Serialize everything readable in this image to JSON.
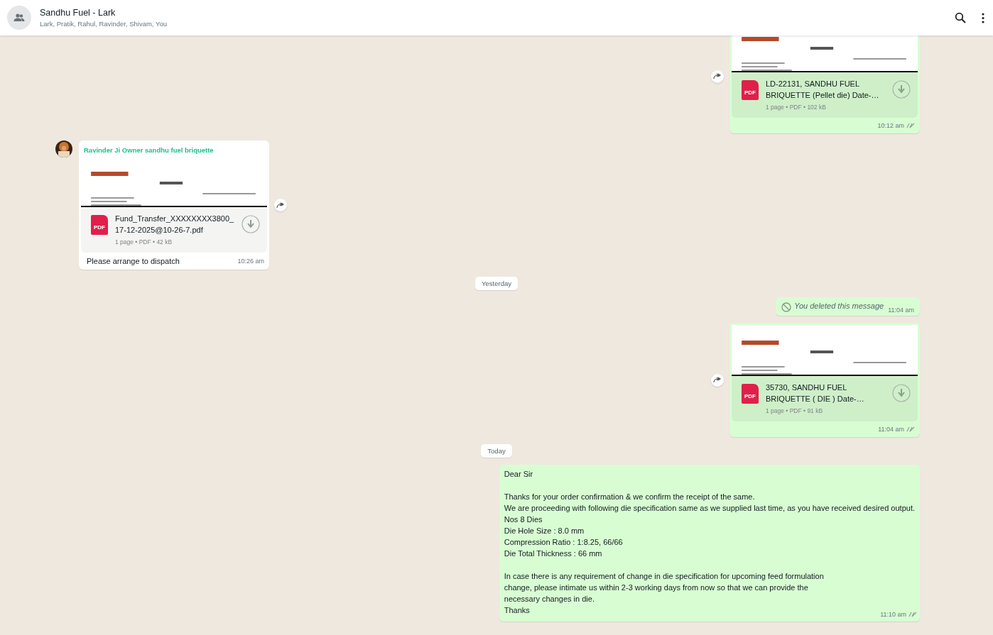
{
  "header": {
    "title": "Sandhu Fuel - Lark",
    "members": "Lark, Pratik, Rahul, Ravinder, Shivam, You"
  },
  "messages": [
    {
      "kind": "document",
      "outgoing": true,
      "file_name": "LD-22131, SANDHU FUEL BRIQUETTE (Pellet die) Date-…",
      "badge": "PDF",
      "meta": "1 page • PDF • 102 kB",
      "time": "10:12 am",
      "read": false
    },
    {
      "kind": "document",
      "outgoing": false,
      "sender": "Ravinder Ji Owner sandhu fuel briquette",
      "file_name": "Fund_Transfer_XXXXXXXX3800_17-12-2025@10-26-7.pdf",
      "badge": "PDF",
      "meta": "1 page • PDF • 42 kB",
      "caption": "Please arrange to dispatch",
      "time": "10:26 am"
    },
    {
      "kind": "date",
      "label": "Yesterday"
    },
    {
      "kind": "deleted",
      "outgoing": true,
      "text": "You deleted this message",
      "time": "11:04 am"
    },
    {
      "kind": "document",
      "outgoing": true,
      "file_name": "35730, SANDHU FUEL BRIQUETTE ( DIE ) Date-…",
      "badge": "PDF",
      "meta": "1 page • PDF • 91 kB",
      "time": "11:04 am",
      "read": false
    },
    {
      "kind": "date",
      "label": "Today"
    },
    {
      "kind": "text",
      "outgoing": true,
      "paragraphs": [
        "Dear Sir",
        "Thanks for your order confirmation & we confirm the receipt of the same.\nWe are proceeding with following die specification same as we supplied last time, as you have received desired output.\nNos 8 Dies\nDie Hole Size : 8.0 mm\nCompression Ratio : 1:8.25, 66/66\nDie Total Thickness : 66 mm",
        "In case there is any requirement of change in die specification for upcoming feed formulation\nchange, please intimate us within 2-3 working days from now so that we can provide the\nnecessary changes in die.\nThanks"
      ],
      "time": "11:10 am",
      "read": false
    }
  ]
}
